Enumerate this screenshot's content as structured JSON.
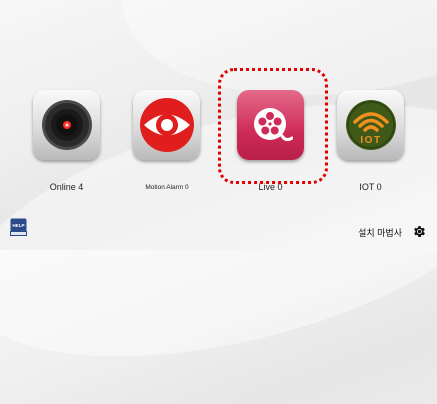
{
  "tiles": [
    {
      "label": "Online 4",
      "icon": "camera-lens-icon"
    },
    {
      "label": "Motion Alarm 0",
      "icon": "eye-icon"
    },
    {
      "label": "Live 0",
      "icon": "film-reel-icon"
    },
    {
      "label": "IOT 0",
      "icon": "iot-wifi-icon",
      "icon_text": "IOT"
    }
  ],
  "footer": {
    "help_badge": "HELP",
    "help_icon": "help-book-icon",
    "wizard_label": "설치 마법사",
    "settings_icon": "gear-icon"
  },
  "colors": {
    "selection_border": "#e10000",
    "live_tile": "#cf2b58",
    "eye_red": "#e01e1e",
    "iot_orange": "#f0901e",
    "iot_green": "#3f5a18"
  }
}
